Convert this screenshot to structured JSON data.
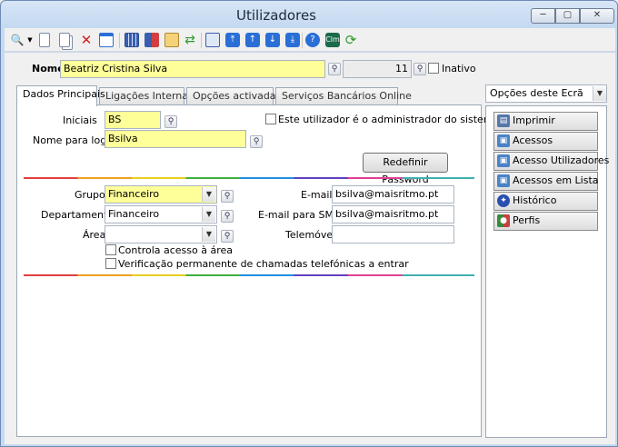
{
  "window": {
    "title": "Utilizadores",
    "minimize": "─",
    "maximize": "▢",
    "close": "✕"
  },
  "toolbar": {
    "icons": [
      "search-icon",
      "new-document-icon",
      "copy-icon",
      "delete-icon",
      "window-icon",
      "table-icon",
      "tree-icon",
      "mail-icon",
      "refresh-icon",
      "preview-icon",
      "first-record-icon",
      "previous-record-icon",
      "next-record-icon",
      "last-record-icon",
      "help-icon",
      "clm-icon",
      "update-icon"
    ]
  },
  "header": {
    "name_label": "Nome",
    "name_value": "Beatriz Cristina Silva",
    "id_value": "11",
    "inactive_label": "Inativo"
  },
  "tabs": [
    {
      "label": "Dados Principais",
      "active": true
    },
    {
      "label": "Ligações Internas",
      "active": false
    },
    {
      "label": "Opções activadas",
      "active": false
    },
    {
      "label": "Serviços Bancários Online",
      "active": false
    }
  ],
  "form": {
    "initials_label": "Iniciais",
    "initials_value": "BS",
    "login_label": "Nome para login",
    "login_value": "Bsilva",
    "admin_label": "Este utilizador é o administrador do sistema",
    "reset_password": "Redefinir Password",
    "group_label": "Grupo",
    "group_value": "Financeiro",
    "department_label": "Departamento",
    "department_value": "Financeiro",
    "area_label": "Área",
    "area_value": "",
    "email_label": "E-mail",
    "email_value": "bsilva@maisritmo.pt",
    "sms_label": "E-mail para SMS",
    "sms_value": "bsilva@maisritmo.pt",
    "mobile_label": "Telemóvel",
    "mobile_value": "",
    "control_area_label": "Controla acesso à área",
    "call_check_label": "Verificação permanente de chamadas telefónicas a entrar"
  },
  "side": {
    "title": "Opções deste Ecrã",
    "buttons": [
      "Imprimir",
      "Acessos",
      "Acesso Utilizadores",
      "Acessos em Lista",
      "Histórico",
      "Perfis"
    ]
  }
}
